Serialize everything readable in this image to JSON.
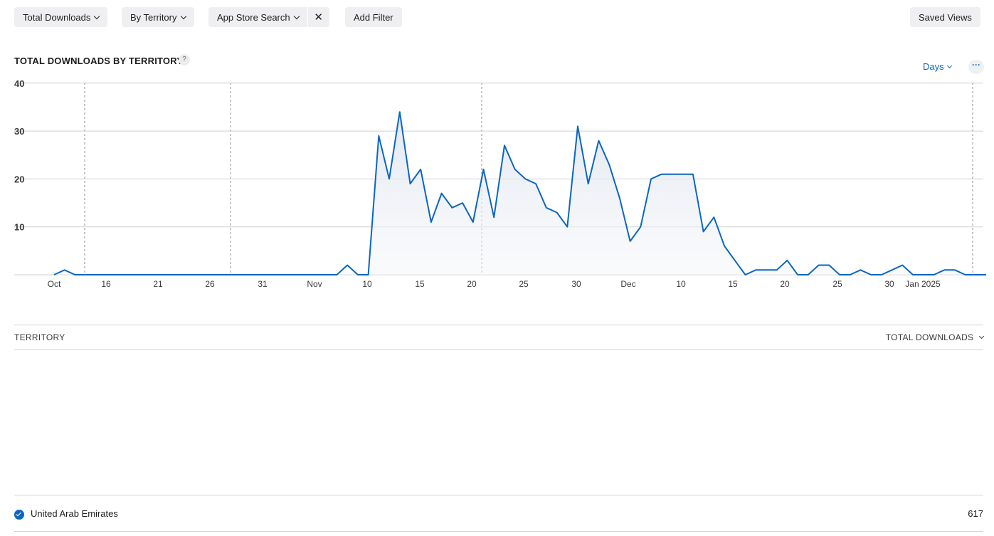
{
  "toolbar": {
    "measure": "Total Downloads",
    "group": "By Territory",
    "filter": "App Store Search",
    "filter_clear": "✕",
    "add_filter": "Add Filter",
    "saved_views": "Saved Views"
  },
  "chart_header": {
    "title": "TOTAL DOWNLOADS BY TERRITORY",
    "help": "?",
    "granularity": "Days",
    "more": "···"
  },
  "chart_data": {
    "type": "area",
    "title": "TOTAL DOWNLOADS BY TERRITORY",
    "ylim": [
      0,
      40
    ],
    "yticks": [
      10,
      20,
      30,
      40
    ],
    "grid": true,
    "x": [
      "2024-10-11",
      "2024-10-12",
      "2024-10-13",
      "2024-10-14",
      "2024-10-15",
      "2024-10-16",
      "2024-10-17",
      "2024-10-18",
      "2024-10-19",
      "2024-10-20",
      "2024-10-21",
      "2024-10-22",
      "2024-10-23",
      "2024-10-24",
      "2024-10-25",
      "2024-10-26",
      "2024-10-27",
      "2024-10-28",
      "2024-10-29",
      "2024-10-30",
      "2024-10-31",
      "2024-11-01",
      "2024-11-02",
      "2024-11-03",
      "2024-11-04",
      "2024-11-05",
      "2024-11-06",
      "2024-11-07",
      "2024-11-08",
      "2024-11-09",
      "2024-11-10",
      "2024-11-11",
      "2024-11-12",
      "2024-11-13",
      "2024-11-14",
      "2024-11-15",
      "2024-11-16",
      "2024-11-17",
      "2024-11-18",
      "2024-11-19",
      "2024-11-20",
      "2024-11-21",
      "2024-11-22",
      "2024-11-23",
      "2024-11-24",
      "2024-11-25",
      "2024-11-26",
      "2024-11-27",
      "2024-11-28",
      "2024-11-29",
      "2024-11-30",
      "2024-12-01",
      "2024-12-02",
      "2024-12-03",
      "2024-12-04",
      "2024-12-05",
      "2024-12-06",
      "2024-12-07",
      "2024-12-08",
      "2024-12-09",
      "2024-12-10",
      "2024-12-11",
      "2024-12-12",
      "2024-12-13",
      "2024-12-14",
      "2024-12-15",
      "2024-12-16",
      "2024-12-17",
      "2024-12-18",
      "2024-12-19",
      "2024-12-20",
      "2024-12-21",
      "2024-12-22",
      "2024-12-23",
      "2024-12-24",
      "2024-12-25",
      "2024-12-26",
      "2024-12-27",
      "2024-12-28",
      "2024-12-29",
      "2024-12-30",
      "2024-12-31",
      "2025-01-01",
      "2025-01-02",
      "2025-01-03",
      "2025-01-04",
      "2025-01-05",
      "2025-01-06"
    ],
    "series": [
      {
        "values": [
          0,
          1,
          0,
          0,
          0,
          0,
          0,
          0,
          0,
          0,
          0,
          0,
          0,
          0,
          0,
          0,
          0,
          0,
          0,
          0,
          0,
          0,
          0,
          0,
          0,
          0,
          0,
          0,
          2,
          0,
          0,
          29,
          20,
          34,
          19,
          22,
          11,
          17,
          14,
          15,
          11,
          22,
          12,
          27,
          22,
          20,
          19,
          14,
          13,
          10,
          31,
          19,
          28,
          23,
          16,
          7,
          10,
          20,
          21,
          21,
          21,
          21,
          9,
          12,
          6,
          3,
          0,
          1,
          1,
          1,
          3,
          0,
          0,
          2,
          2,
          0,
          0,
          1,
          0,
          0,
          1,
          2,
          0,
          0,
          0,
          1,
          1,
          0,
          0,
          0
        ]
      }
    ],
    "x_tick_labels": [
      "Oct",
      "16",
      "21",
      "26",
      "31",
      "Nov",
      "10",
      "15",
      "20",
      "25",
      "30",
      "Dec",
      "10",
      "15",
      "20",
      "25",
      "30",
      "Jan 2025"
    ],
    "y_tick_labels": [
      "10",
      "20",
      "30",
      "40"
    ],
    "color": "#0a66c2"
  },
  "table": {
    "col_territory": "TERRITORY",
    "col_downloads": "TOTAL DOWNLOADS",
    "rows": [
      {
        "territory": "United Arab Emirates",
        "downloads": "617"
      }
    ]
  }
}
